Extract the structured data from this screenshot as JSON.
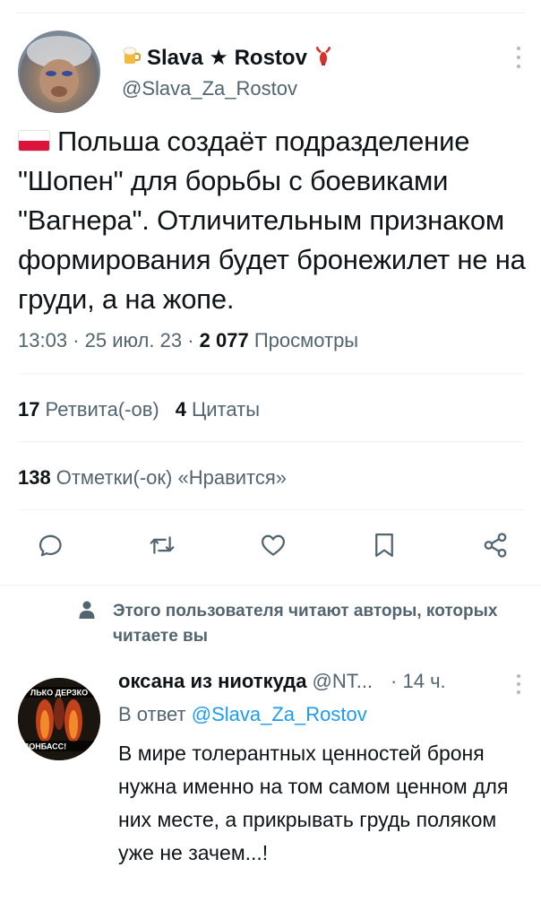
{
  "tweet": {
    "display_name": "Slava ★ Rostov",
    "badge_left": "beer-mug-icon",
    "badge_right": "crawfish-icon",
    "handle": "@Slava_Za_Rostov",
    "flag": "poland-flag-icon",
    "text": "Польша создаёт подразделение \"Шопен\" для борьбы с боевиками \"Вагнера\". Отличительным признаком формирования будет бронежилет не на груди, а на жопе.",
    "time": "13:03",
    "date": "25 июл. 23",
    "views_count": "2 077",
    "views_label": "Просмотры",
    "separator": "·"
  },
  "stats": {
    "retweets_count": "17",
    "retweets_label": "Ретвита(-ов)",
    "quotes_count": "4",
    "quotes_label": "Цитаты",
    "likes_count": "138",
    "likes_label": "Отметки(-ок) «Нравится»"
  },
  "actions": [
    "reply-icon",
    "retweet-icon",
    "like-icon",
    "bookmark-icon",
    "share-icon"
  ],
  "notice": {
    "icon": "person-icon",
    "text": "Этого пользователя читают авторы, которых читаете вы"
  },
  "reply": {
    "display_name": "оксана из ниоткуда",
    "handle": "@NT...",
    "dot": "·",
    "time": "14 ч.",
    "avatar_caption_top": "ЛЬКО ДЕРЗКО",
    "avatar_caption_bottom": "ДОНБАСС!",
    "reply_to_prefix": "В ответ",
    "reply_to_handle": "@Slava_Za_Rostov",
    "text": "В мире толерантных ценностей броня нужна именно на том самом ценном для них месте, а прикрывать грудь поляком уже не зачем...!"
  },
  "colors": {
    "text": "#0f1419",
    "secondary": "#536471",
    "link": "#1d9bf0",
    "divider": "#eff3f4"
  }
}
